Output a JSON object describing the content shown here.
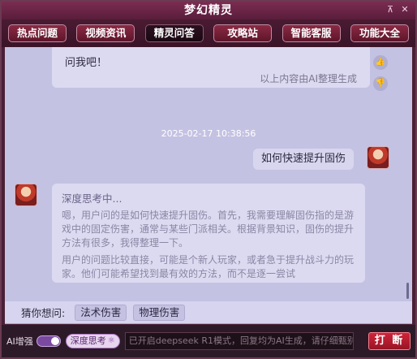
{
  "window": {
    "title": "梦幻精灵",
    "pin_glyph": "⊼",
    "close_glyph": "✕"
  },
  "nav": {
    "tabs": [
      {
        "label": "热点问题"
      },
      {
        "label": "视频资讯"
      },
      {
        "label": "精灵问答",
        "active": true
      },
      {
        "label": "攻略站"
      },
      {
        "label": "智能客服"
      },
      {
        "label": "功能大全"
      }
    ]
  },
  "chat": {
    "prev_bubble": {
      "text": "问我吧！",
      "footer": "以上内容由AI整理生成"
    },
    "timestamp": "2025-02-17 10:38:56",
    "user_message": "如何快速提升固伤",
    "bot_reply": {
      "status": "深度思考中...",
      "paragraphs": [
        "嗯，用户问的是如何快速提升固伤。首先，我需要理解固伤指的是游戏中的固定伤害，通常与某些门派相关。根据背景知识，固伤的提升方法有很多，我得整理一下。",
        "用户的问题比较直接，可能是个新人玩家，或者急于提升战斗力的玩家。他们可能希望找到最有效的方法，而不是逐一尝试"
      ]
    }
  },
  "guess": {
    "label": "猜你想问:",
    "chips": [
      "法术伤害",
      "物理伤害"
    ]
  },
  "bottom": {
    "ai_label": "AI增强",
    "ai_enabled": true,
    "deep_think_label": "深度思考",
    "input_placeholder": "已开启deepseek R1模式，回复均为AI生成，请仔细甄别",
    "send_label": "打 断"
  },
  "colors": {
    "title_bar": "#7a2c52",
    "chat_bg": "#c4c2e2",
    "send_button": "#d0243a"
  }
}
